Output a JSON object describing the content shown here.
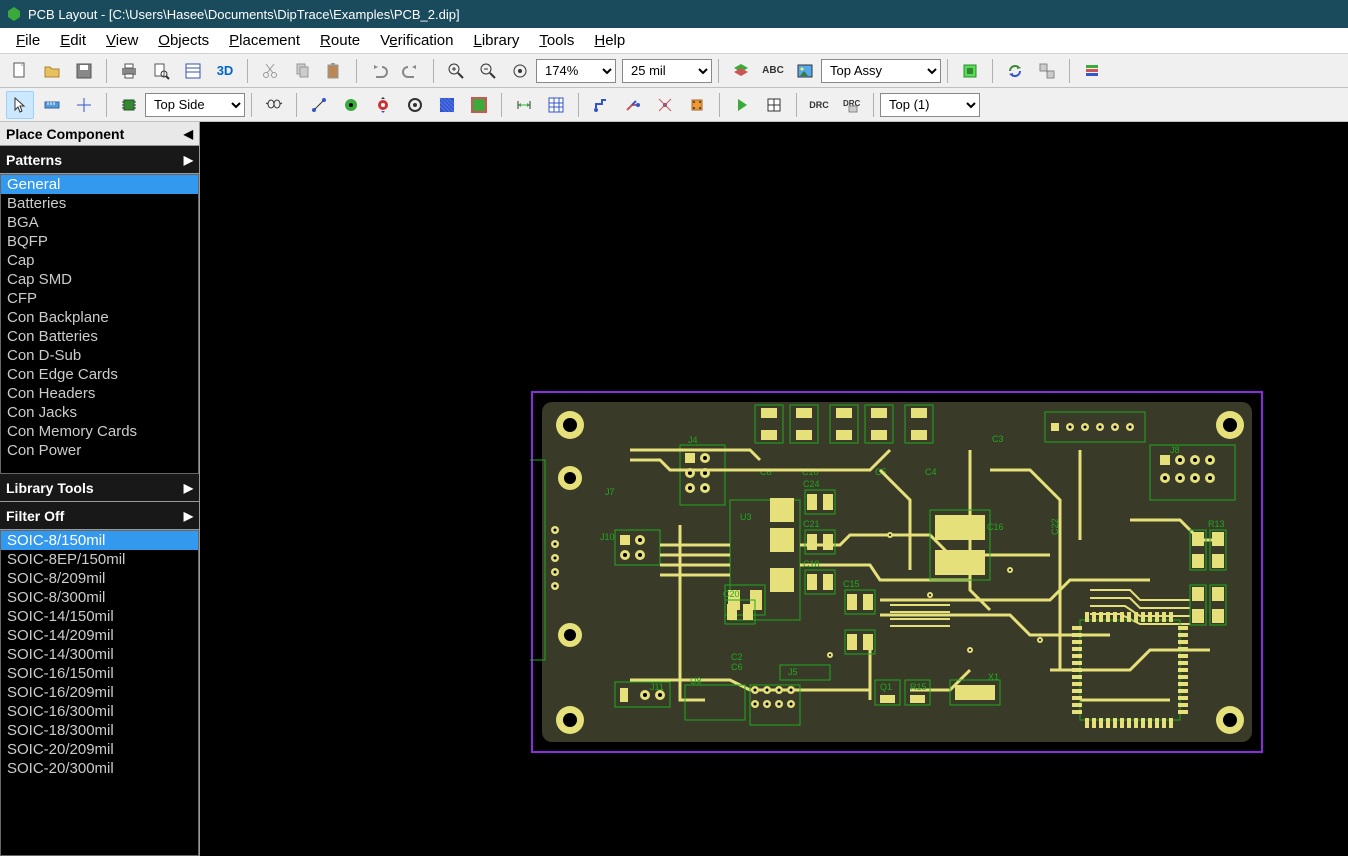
{
  "title": "PCB Layout - [C:\\Users\\Hasee\\Documents\\DipTrace\\Examples\\PCB_2.dip]",
  "menu": [
    "File",
    "Edit",
    "View",
    "Objects",
    "Placement",
    "Route",
    "Verification",
    "Library",
    "Tools",
    "Help"
  ],
  "zoom": "174%",
  "grid": "25 mil",
  "layer_combo": "Top Assy",
  "layer2": "Top (1)",
  "side": "Top Side",
  "sidebar": {
    "title": "Place Component",
    "section": "Patterns",
    "lib_tools": "Library Tools",
    "filter": "Filter Off"
  },
  "libraries": [
    "General",
    "Batteries",
    "BGA",
    "BQFP",
    "Cap",
    "Cap SMD",
    "CFP",
    "Con Backplane",
    "Con Batteries",
    "Con D-Sub",
    "Con Edge Cards",
    "Con Headers",
    "Con Jacks",
    "Con Memory Cards",
    "Con Power"
  ],
  "libraries_sel": 0,
  "components": [
    "SOIC-8/150mil",
    "SOIC-8EP/150mil",
    "SOIC-8/209mil",
    "SOIC-8/300mil",
    "SOIC-14/150mil",
    "SOIC-14/209mil",
    "SOIC-14/300mil",
    "SOIC-16/150mil",
    "SOIC-16/209mil",
    "SOIC-16/300mil",
    "SOIC-18/300mil",
    "SOIC-20/209mil",
    "SOIC-20/300mil"
  ],
  "components_sel": 0,
  "refs": {
    "j4": "J4",
    "j7": "J7",
    "j10": "J10",
    "j11": "J11",
    "j5": "J5",
    "j8": "J8",
    "u3": "U3",
    "u8": "U8",
    "c8": "C8",
    "c10": "C10",
    "c3": "C3",
    "c5": "C5",
    "c24": "C24",
    "c21": "C21",
    "c18": "C18",
    "c20": "C20",
    "c15": "C15",
    "c16": "C16",
    "c2": "C2",
    "c6": "C6",
    "c4": "C4",
    "c22": "C22",
    "q1": "Q1",
    "r15": "R15",
    "r13": "R13",
    "x1": "X1"
  }
}
